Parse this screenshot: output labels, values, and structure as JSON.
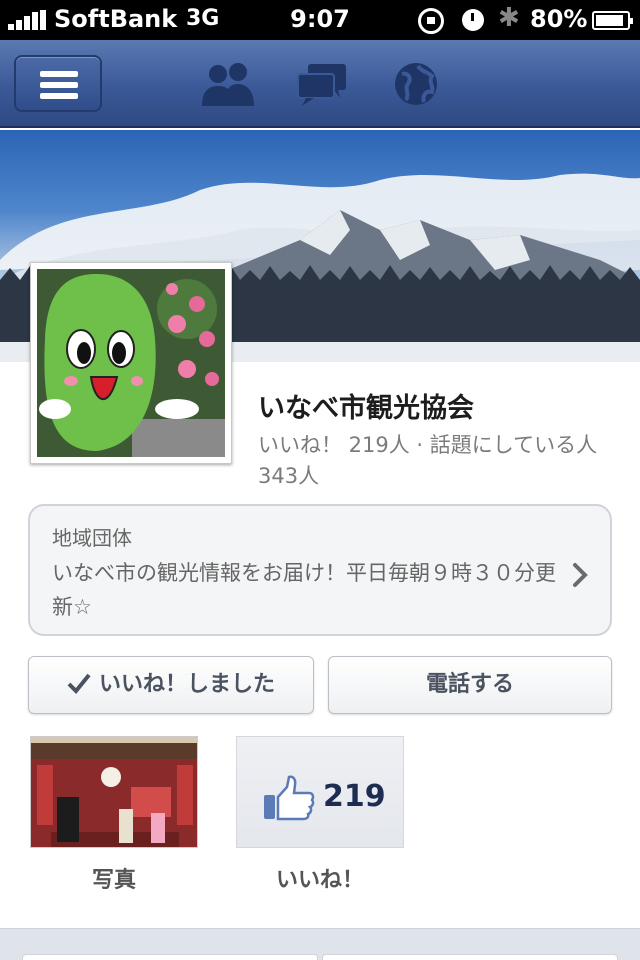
{
  "status_bar": {
    "carrier": "SoftBank",
    "network": "3G",
    "time": "9:07",
    "battery": "80%",
    "icons": [
      "signal-icon",
      "orientation-lock-icon",
      "alarm-icon",
      "bluetooth-icon",
      "battery-icon"
    ]
  },
  "nav_bar": {
    "icons": [
      "menu-icon",
      "friends-icon",
      "messages-icon",
      "notifications-icon"
    ],
    "color": "#3b5998"
  },
  "page": {
    "name": "いなべ市観光協会",
    "stats": "いいね！ 219人 · 話題にしている人343人"
  },
  "about": {
    "category": "地域団体",
    "description": "いなべ市の観光情報をお届け！平日毎朝９時３０分更新☆"
  },
  "actions": {
    "liked_label": "いいね！しました",
    "call_label": "電話する"
  },
  "tiles": {
    "photos_label": "写真",
    "likes_count": "219",
    "likes_label": "いいね！"
  }
}
